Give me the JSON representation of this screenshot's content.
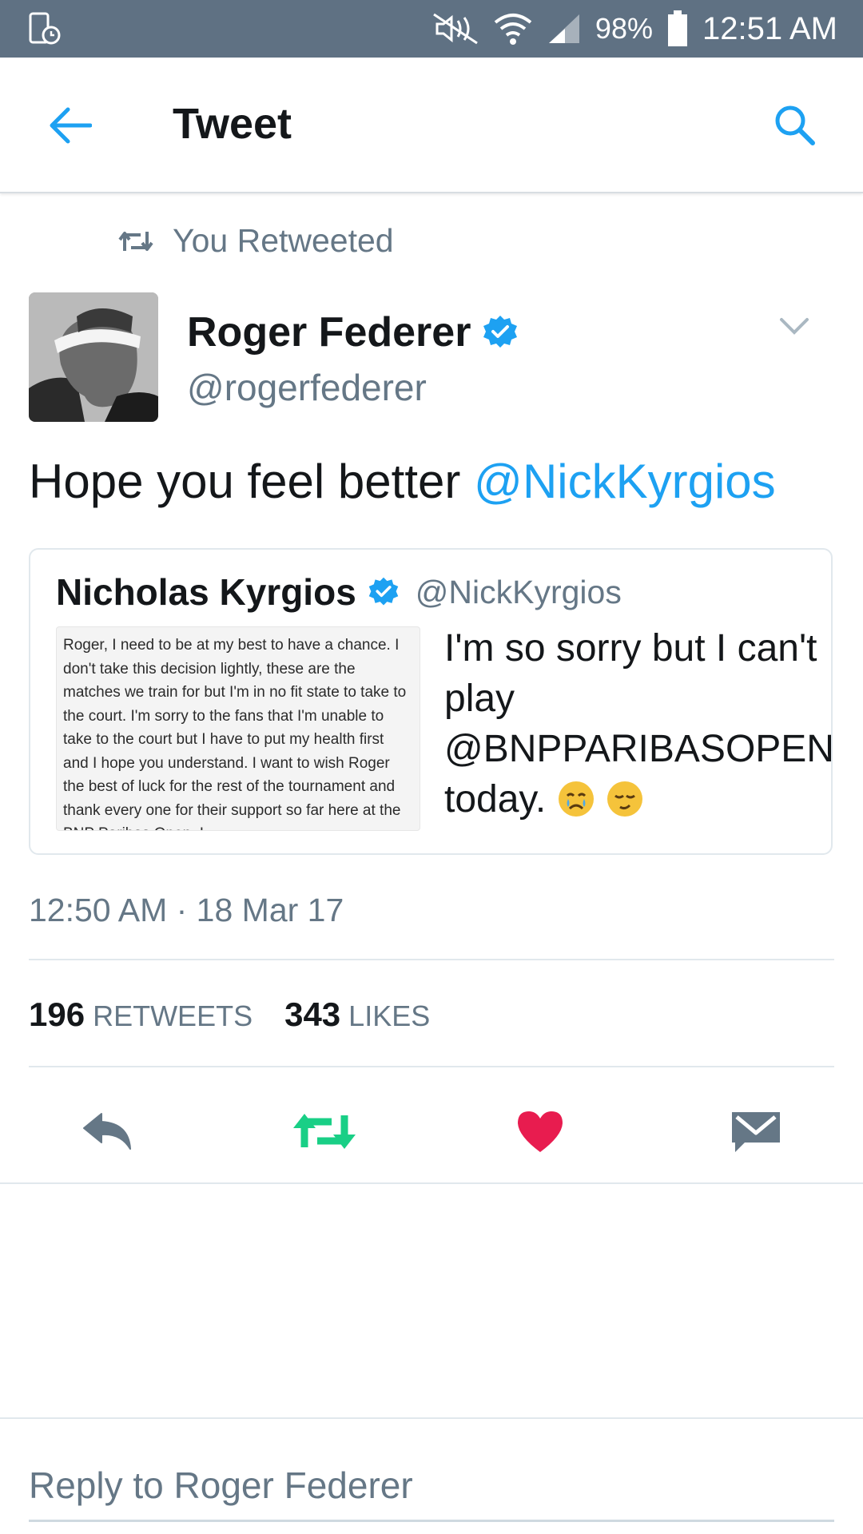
{
  "status_bar": {
    "battery_percent": "98%",
    "time": "12:51 AM"
  },
  "app_bar": {
    "title": "Tweet",
    "back_icon": "arrow-left-icon",
    "search_icon": "search-icon"
  },
  "tweet": {
    "retweet_context": "You Retweeted",
    "author_name": "Roger Federer",
    "author_handle": "@rogerfederer",
    "verified": true,
    "text": "Hope you feel better ",
    "mention": "@NickKyrgios",
    "quoted": {
      "author_name": "Nicholas Kyrgios",
      "author_handle": "@NickKyrgios",
      "image_text": "Roger, I need to be at my best to have a chance. I don't take this decision lightly, these are the matches we train for but I'm in no fit state to take to the court. I'm sorry to the fans that I'm unable to take to the court but I have to put my health first and I hope you understand. I want to wish Roger the best of luck for the rest of the tournament and thank every one for their support so far here at the BNP Paribas Open. I",
      "text": "I'm so sorry but I can't play @BNPPARIBASOPEN today."
    },
    "timestamp": "12:50 AM · 18 Mar 17",
    "retweets_count": "196",
    "retweets_label": "RETWEETS",
    "likes_count": "343",
    "likes_label": "LIKES"
  },
  "actions": {
    "reply_icon": "reply-icon",
    "retweet_icon": "retweet-icon",
    "like_icon": "heart-icon",
    "dm_icon": "envelope-icon"
  },
  "colors": {
    "status_bar": "#5f7183",
    "link": "#1da1f2",
    "retweet_active": "#19cf86",
    "like_active": "#e81c4f",
    "secondary_text": "#657786"
  },
  "reply_box": {
    "placeholder": "Reply to Roger Federer"
  }
}
